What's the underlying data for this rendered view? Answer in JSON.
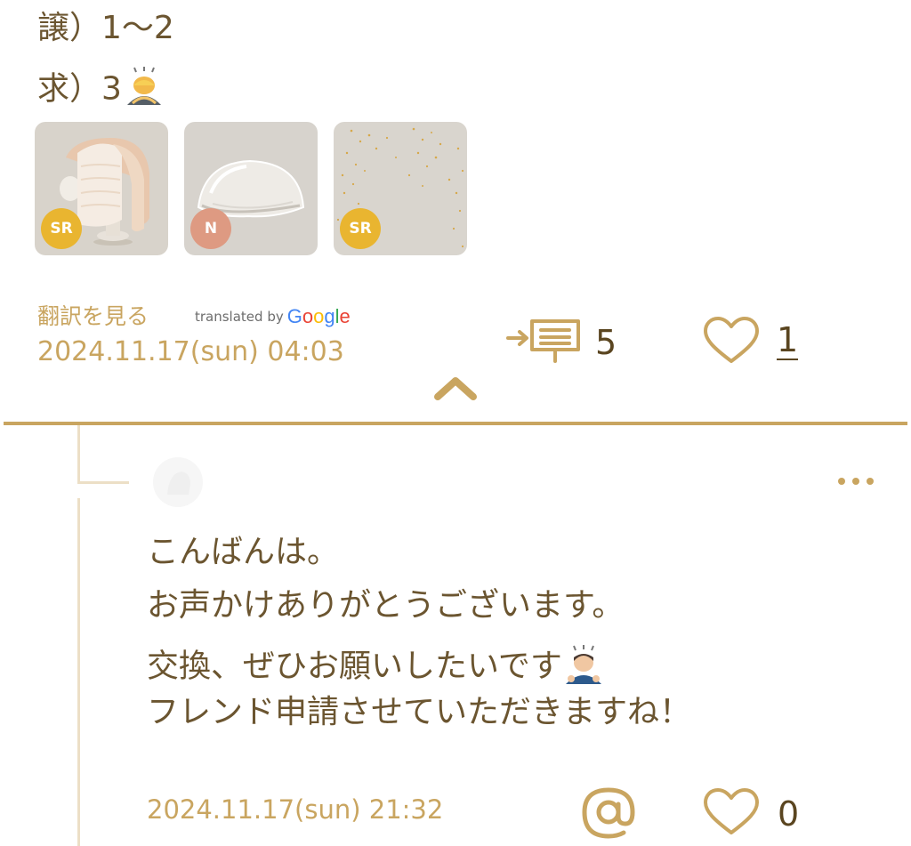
{
  "post": {
    "lines": [
      "譲）1～2",
      "求）3"
    ],
    "items": [
      {
        "rarity": "SR",
        "icon": "hairstyle-icon"
      },
      {
        "rarity": "N",
        "icon": "dome-hat-icon"
      },
      {
        "rarity": "SR",
        "icon": "sparkle-background-icon"
      }
    ],
    "translate_label": "翻訳を見る",
    "translated_by": "translated by",
    "google": [
      "G",
      "o",
      "o",
      "g",
      "l",
      "e"
    ],
    "timestamp": "2024.11.17(sun) 04:03",
    "reply_count": "5",
    "like_count": "1"
  },
  "reply": {
    "lines": [
      "こんばんは。",
      "お声かけありがとうございます。",
      "交換、ぜひお願いしたいです",
      "フレンド申請させていただきますね！"
    ],
    "timestamp": "2024.11.17(sun) 21:32",
    "like_count": "0"
  },
  "colors": {
    "accent": "#c9a560",
    "text": "#6b5530",
    "badge_sr": "#e9b530",
    "badge_n": "#de9a82"
  }
}
